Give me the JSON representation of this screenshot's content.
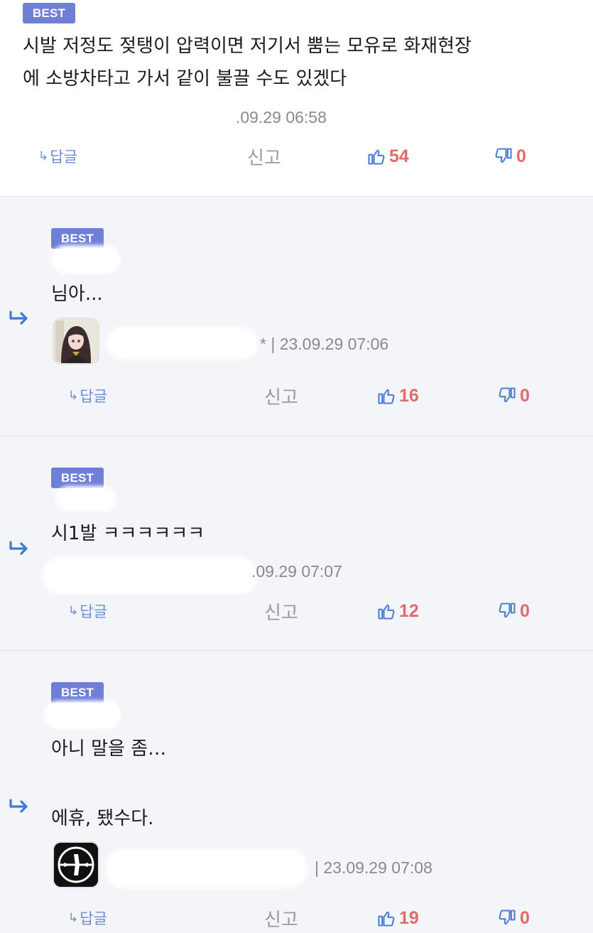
{
  "colors": {
    "badge": "#6f7fd8",
    "accent": "#4f7fd4",
    "count": "#e06b6b",
    "reply_bg": "#f4f5f8"
  },
  "comments": [
    {
      "badge": "BEST",
      "lines": [
        "시발 저정도 젖탱이 압력이면 저기서 뿜는 모유로 화재현장",
        "에 소방차타고 가서 같이 불끌 수도 있겠다"
      ],
      "meta": ".09.29 06:58",
      "actions": {
        "reply": "답글",
        "report": "신고",
        "likes": "54",
        "dislikes": "0"
      }
    },
    {
      "badge": "BEST",
      "lines": [
        "님아..."
      ],
      "meta": "* | 23.09.29 07:06",
      "avatar": "anime-girl-avatar",
      "actions": {
        "reply": "답글",
        "report": "신고",
        "likes": "16",
        "dislikes": "0"
      }
    },
    {
      "badge": "BEST",
      "lines": [
        "시1발 ㅋㅋㅋㅋㅋㅋ"
      ],
      "meta": ".09.29 07:07",
      "actions": {
        "reply": "답글",
        "report": "신고",
        "likes": "12",
        "dislikes": "0"
      }
    },
    {
      "badge": "BEST",
      "lines": [
        "아니 말을 좀…",
        "에휴, 됐수다."
      ],
      "meta": "| 23.09.29 07:08",
      "avatar": "airplane-avatar",
      "actions": {
        "reply": "답글",
        "report": "신고",
        "likes": "19",
        "dislikes": "0"
      }
    }
  ]
}
